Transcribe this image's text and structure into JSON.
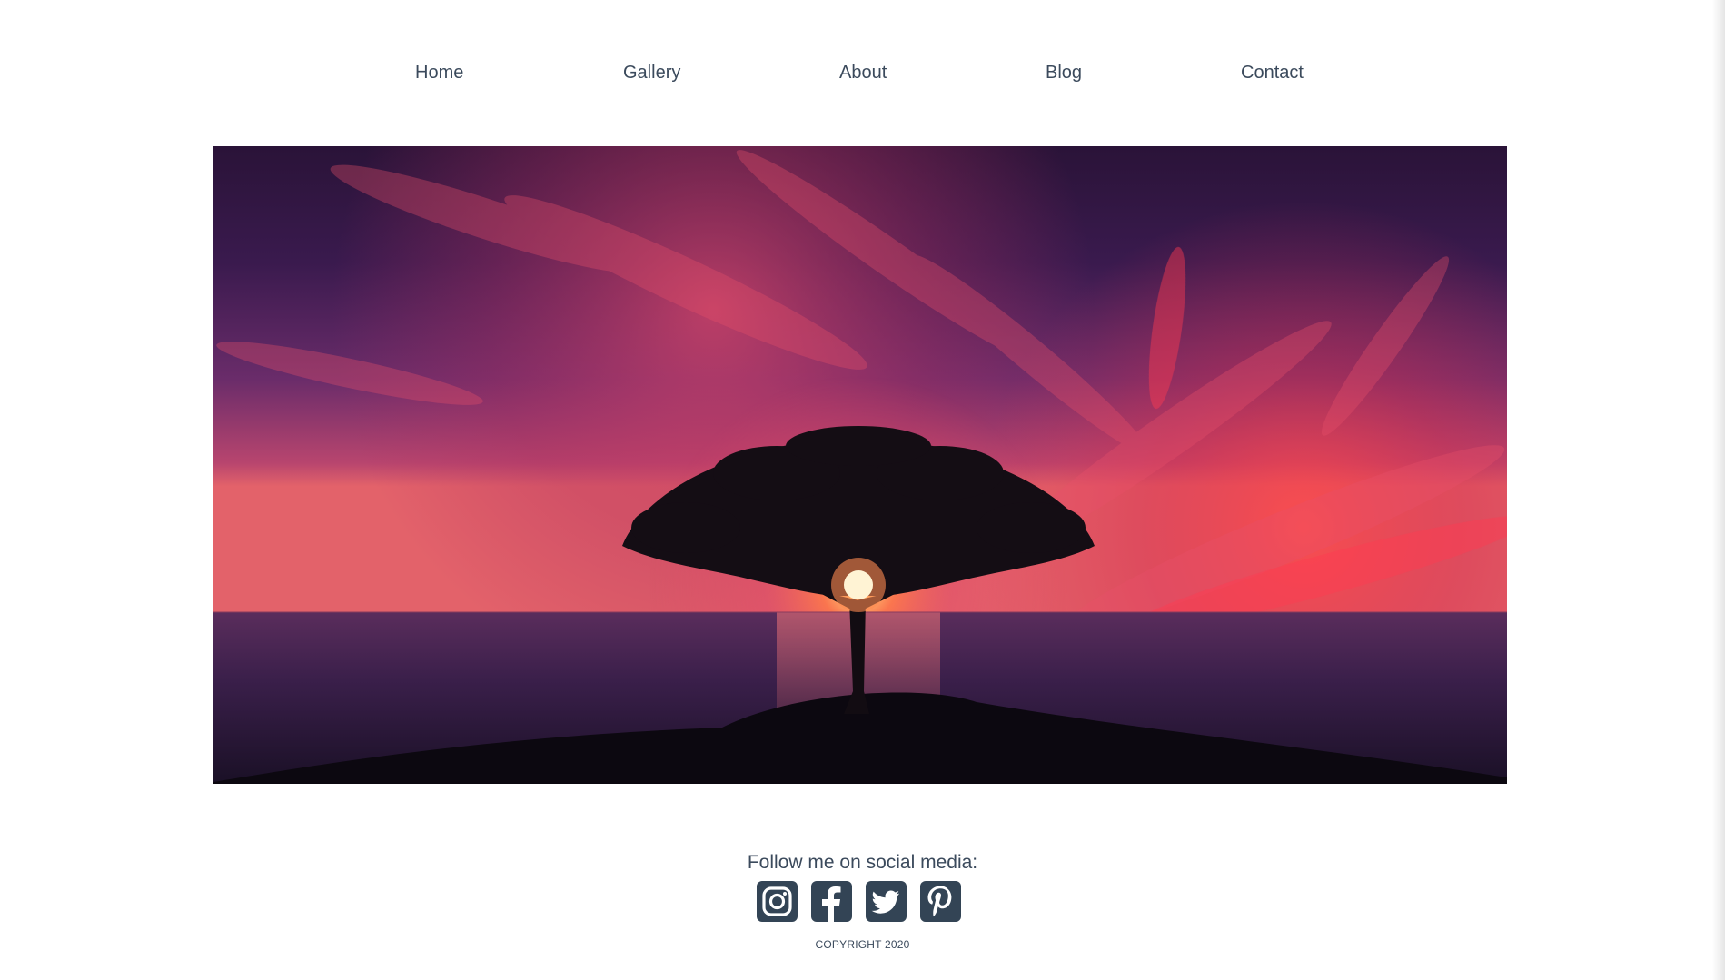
{
  "nav": {
    "items": [
      {
        "label": "Home"
      },
      {
        "label": "Gallery"
      },
      {
        "label": "About"
      },
      {
        "label": "Blog"
      },
      {
        "label": "Contact"
      }
    ]
  },
  "hero": {
    "image": "sunset-tree-over-sea"
  },
  "footer": {
    "follow_text": "Follow me on social media:",
    "social": [
      {
        "icon": "instagram-icon"
      },
      {
        "icon": "facebook-icon"
      },
      {
        "icon": "twitter-icon"
      },
      {
        "icon": "pinterest-icon"
      }
    ],
    "copyright": "COPYRIGHT 2020",
    "icon_color": "#334455"
  },
  "colors": {
    "text": "#3b4a5c",
    "background": "#ffffff"
  }
}
